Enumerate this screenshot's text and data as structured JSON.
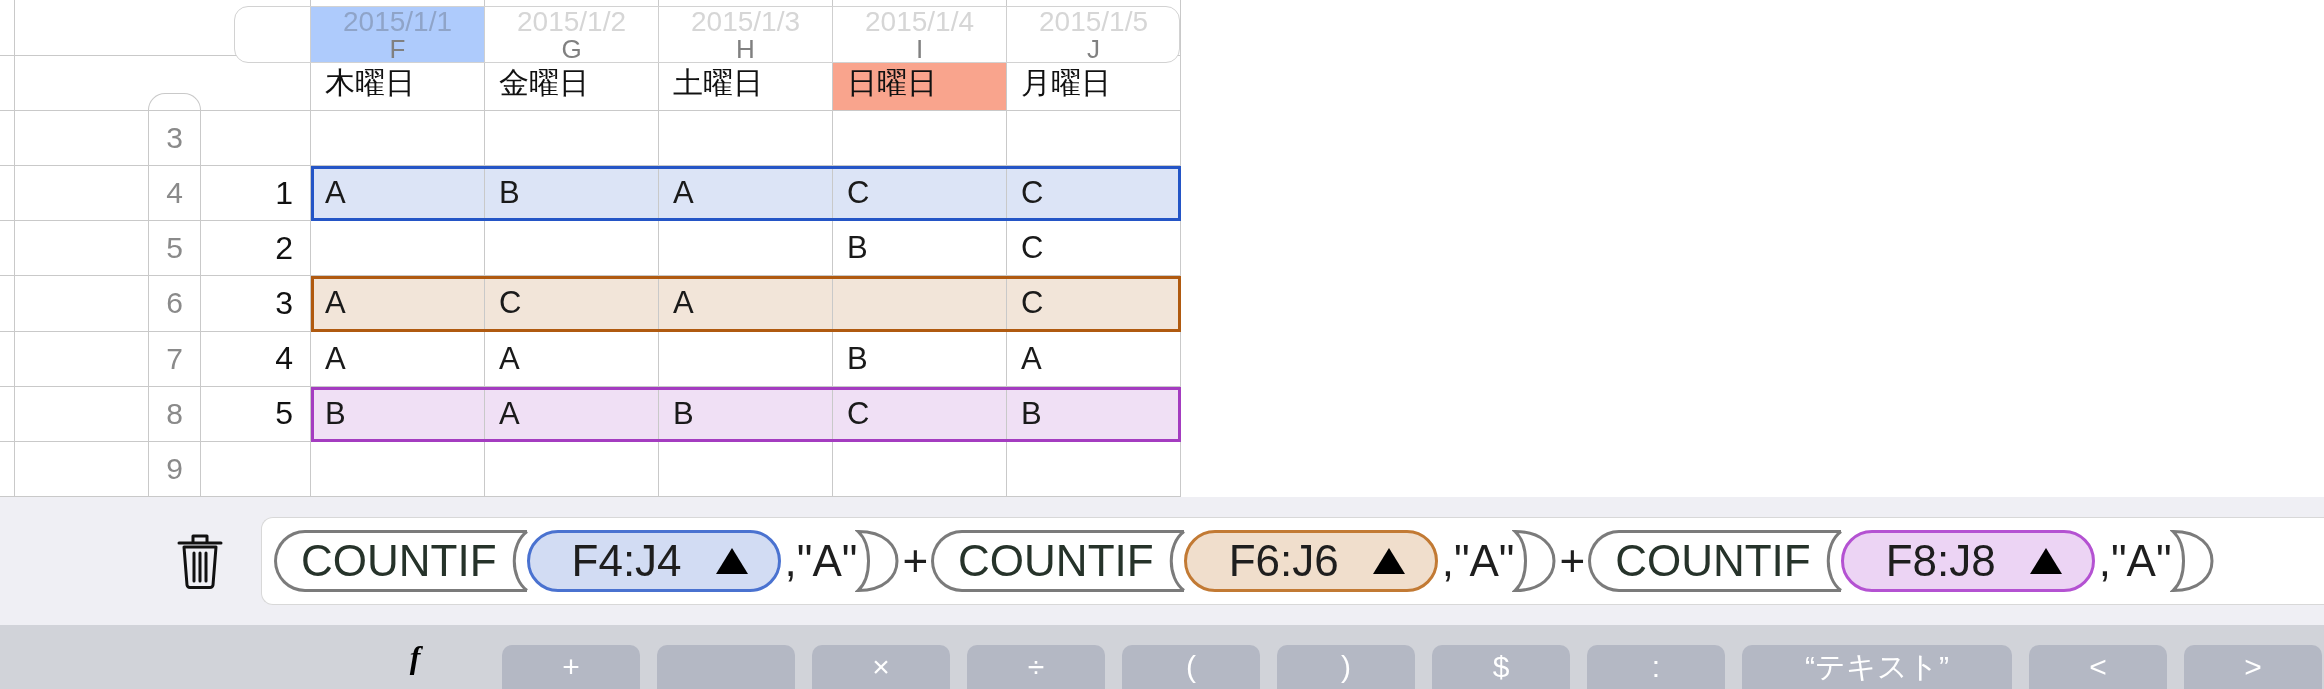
{
  "sheet": {
    "columns": [
      {
        "letter": "F",
        "date": "2015/1/1",
        "selected": true
      },
      {
        "letter": "G",
        "date": "2015/1/2",
        "selected": false
      },
      {
        "letter": "H",
        "date": "2015/1/3",
        "selected": false
      },
      {
        "letter": "I",
        "date": "2015/1/4",
        "selected": false
      },
      {
        "letter": "J",
        "date": "2015/1/5",
        "selected": false
      }
    ],
    "day_row": [
      {
        "text": "木曜日"
      },
      {
        "text": "金曜日"
      },
      {
        "text": "土曜日"
      },
      {
        "text": "日曜日",
        "color": "#f9a48d"
      },
      {
        "text": "月曜日"
      }
    ],
    "rows": [
      {
        "label": "3"
      },
      {
        "label": "4",
        "index": "1",
        "color": "#2455c6",
        "cells": [
          "A",
          "B",
          "A",
          "C",
          "C"
        ]
      },
      {
        "label": "5",
        "index": "2",
        "cells": [
          null,
          null,
          null,
          "B",
          "C"
        ]
      },
      {
        "label": "6",
        "index": "3",
        "color": "#b05a10",
        "cells": [
          "A",
          "C",
          "A",
          null,
          "C"
        ]
      },
      {
        "label": "7",
        "index": "4",
        "cells": [
          "A",
          "A",
          null,
          "B",
          "A"
        ]
      },
      {
        "label": "8",
        "index": "5",
        "color": "#a43cc0",
        "cells": [
          "B",
          "A",
          "B",
          "C",
          "B"
        ]
      },
      {
        "label": "9"
      }
    ]
  },
  "formula": {
    "tokens": [
      {
        "kind": "function",
        "text": "COUNTIF"
      },
      {
        "kind": "range",
        "text": "F4:J4",
        "color": "#4a72d0"
      },
      {
        "kind": "literal",
        "text": ",\"A\""
      },
      {
        "kind": "close"
      },
      {
        "kind": "operator",
        "text": "+"
      },
      {
        "kind": "function",
        "text": "COUNTIF"
      },
      {
        "kind": "range",
        "text": "F6:J6",
        "color": "#c27a34"
      },
      {
        "kind": "literal",
        "text": ",\"A\""
      },
      {
        "kind": "close"
      },
      {
        "kind": "operator",
        "text": "+"
      },
      {
        "kind": "function",
        "text": "COUNTIF"
      },
      {
        "kind": "range",
        "text": "F8:J8",
        "color": "#b452d2"
      },
      {
        "kind": "literal",
        "text": ",\"A\""
      },
      {
        "kind": "close"
      }
    ]
  },
  "keyboard": {
    "keys": [
      {
        "kind": "function",
        "label": "f"
      },
      {
        "kind": "key",
        "label": "+"
      },
      {
        "kind": "key"
      },
      {
        "kind": "key",
        "label": "×"
      },
      {
        "kind": "key",
        "label": "÷"
      },
      {
        "kind": "key",
        "label": "("
      },
      {
        "kind": "key",
        "label": ")"
      },
      {
        "kind": "key",
        "label": "$"
      },
      {
        "kind": "key",
        "label": ":"
      },
      {
        "kind": "wide",
        "label": "“テキスト”"
      },
      {
        "kind": "key",
        "label": "<"
      },
      {
        "kind": "key",
        "label": ">"
      }
    ]
  }
}
